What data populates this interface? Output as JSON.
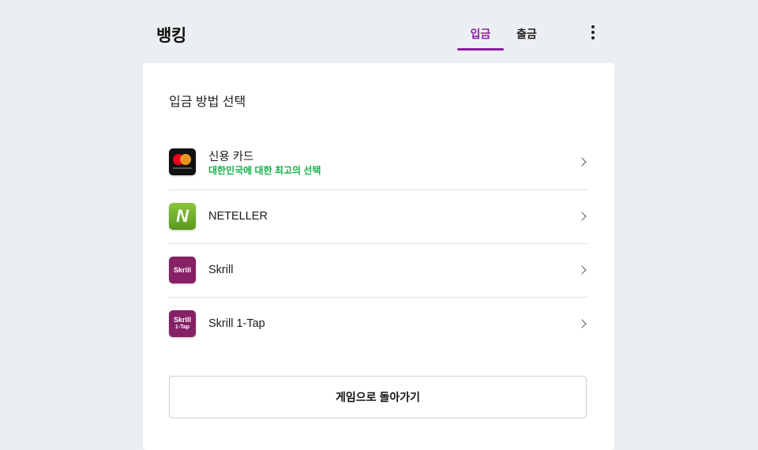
{
  "header": {
    "title": "뱅킹",
    "tabs": [
      {
        "label": "입금",
        "active": true
      },
      {
        "label": "출금",
        "active": false
      }
    ],
    "more_icon": "more-vertical-icon",
    "accent_color": "#8a1fa3"
  },
  "main": {
    "section_title": "입금 방법 선택",
    "methods": [
      {
        "name": "신용 카드",
        "subtitle": "대한민국에 대한 최고의 선택",
        "icon": "mastercard-logo"
      },
      {
        "name": "NETELLER",
        "icon": "neteller-logo",
        "logo_text": "N"
      },
      {
        "name": "Skrill",
        "icon": "skrill-logo",
        "logo_text": "Skrill"
      },
      {
        "name": "Skrill 1-Tap",
        "icon": "skrill-1tap-logo",
        "logo_text": "Skrill",
        "logo_subtext": "1-Tap"
      }
    ],
    "back_button_label": "게임으로 돌아가기",
    "subtitle_color": "#12b24a"
  }
}
